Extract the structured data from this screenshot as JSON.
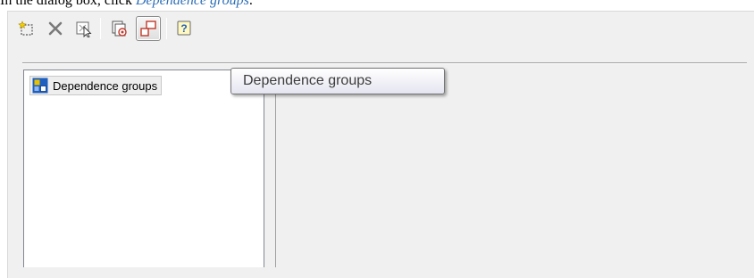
{
  "caption": {
    "prefix": "In the dialog box, click ",
    "link": "Dependence groups",
    "suffix": "."
  },
  "toolbar": {
    "buttons": [
      {
        "icon": "new-item-icon"
      },
      {
        "icon": "delete-icon"
      },
      {
        "icon": "select-objects-icon"
      },
      {
        "icon": "check-icon"
      },
      {
        "icon": "dependence-groups-icon",
        "pressed": true
      },
      {
        "icon": "help-icon"
      }
    ]
  },
  "tooltip": {
    "text": "Dependence groups"
  },
  "tree": {
    "items": [
      {
        "label": "Dependence groups",
        "icon": "dependence-groups-node-icon"
      }
    ]
  },
  "colors": {
    "link": "#2f6fb6",
    "window_bg": "#f0f0f0",
    "delete_x": "#7a7a7a",
    "accent_red": "#c0392b",
    "icon_blue": "#1f5fbf"
  }
}
